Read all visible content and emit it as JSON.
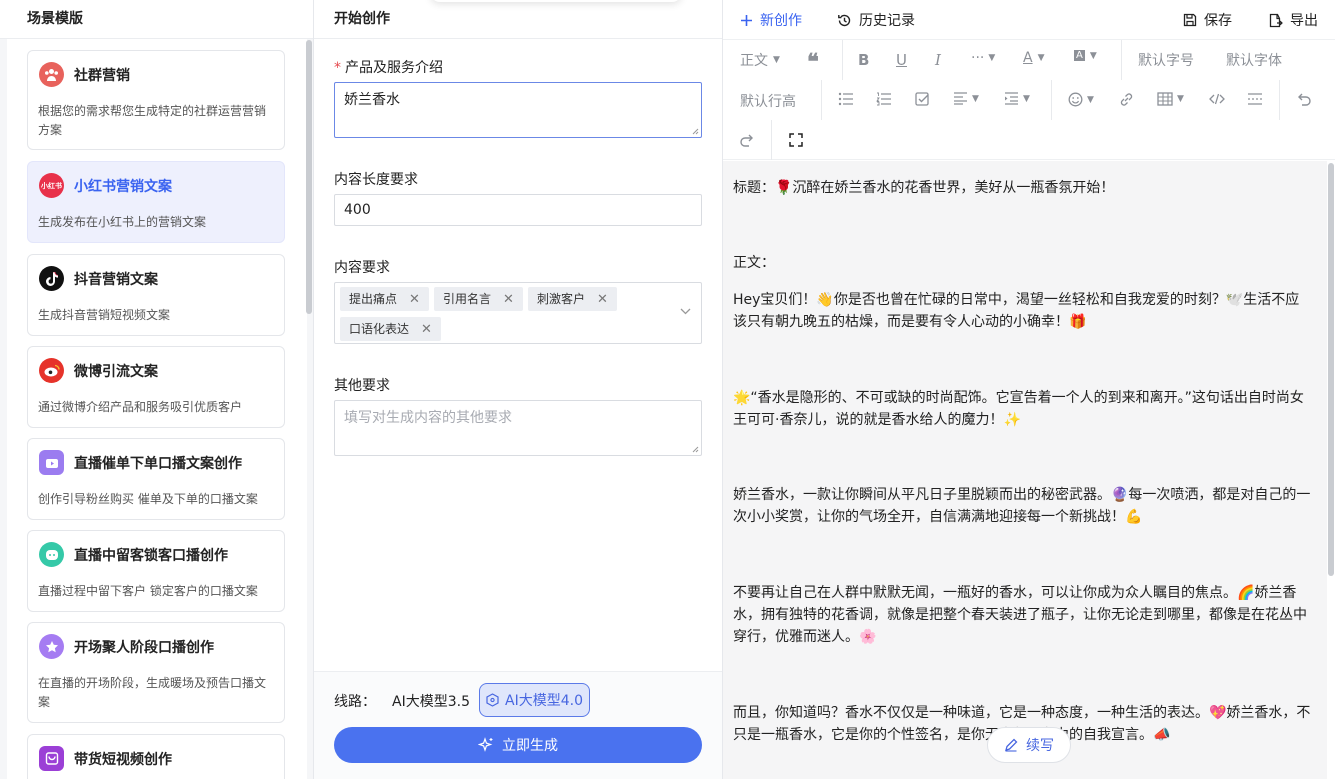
{
  "left": {
    "title": "场景模版",
    "cards": [
      {
        "title": "社群营销",
        "desc": "根据您的需求帮您生成特定的社群运营营销方案",
        "icon": "community-icon",
        "color": "#e8625c"
      },
      {
        "title": "小红书营销文案",
        "desc": "生成发布在小红书上的营销文案",
        "icon": "xiaohongshu-icon",
        "icon_text": "小红书",
        "color": "#e8314a"
      },
      {
        "title": "抖音营销文案",
        "desc": "生成抖音营销短视频文案",
        "icon": "douyin-icon",
        "color": "#111111"
      },
      {
        "title": "微博引流文案",
        "desc": "通过微博介绍产品和服务吸引优质客户",
        "icon": "weibo-icon",
        "color": "#e6332a"
      },
      {
        "title": "直播催单下单口播文案创作",
        "desc": "创作引导粉丝购买 催单及下单的口播文案",
        "icon": "live-order-icon",
        "color": "#9b7cf0"
      },
      {
        "title": "直播中留客锁客口播创作",
        "desc": "直播过程中留下客户 锁定客户的口播文案",
        "icon": "live-retain-icon",
        "color": "#35c9a8"
      },
      {
        "title": "开场聚人阶段口播创作",
        "desc": "在直播的开场阶段，生成暖场及预告口播文案",
        "icon": "opening-star-icon",
        "color": "#a57cf2"
      },
      {
        "title": "带货短视频创作",
        "desc": "",
        "icon": "shopping-video-icon",
        "color": "#9b3fd6"
      }
    ]
  },
  "form": {
    "title": "开始创作",
    "product_label": "产品及服务介绍",
    "product_value": "娇兰香水",
    "length_label": "内容长度要求",
    "length_value": "400",
    "content_label": "内容要求",
    "tags": [
      "提出痛点",
      "引用名言",
      "刺激客户",
      "口语化表达"
    ],
    "other_label": "其他要求",
    "other_placeholder": "填写对生成内容的其他要求",
    "route_label": "线路：",
    "model_35": "AI大模型3.5",
    "model_40": "AI大模型4.0",
    "generate": "立即生成"
  },
  "topbar": {
    "new": "新创作",
    "history": "历史记录",
    "save": "保存",
    "export": "导出"
  },
  "toolbar": {
    "paragraph": "正文",
    "font_size": "默认字号",
    "font_family": "默认字体",
    "line_height": "默认行高"
  },
  "editor": {
    "title_line": "标题：🌹沉醉在娇兰香水的花香世界，美好从一瓶香氛开始！",
    "body_label": "正文：",
    "p1": "Hey宝贝们！👋你是否也曾在忙碌的日常中，渴望一丝轻松和自我宠爱的时刻？🕊️生活不应该只有朝九晚五的枯燥，而是要有令人心动的小确幸！🎁",
    "p2": "🌟“香水是隐形的、不可或缺的时尚配饰。它宣告着一个人的到来和离开。”这句话出自时尚女王可可·香奈儿，说的就是香水给人的魔力！✨",
    "p3": "娇兰香水，一款让你瞬间从平凡日子里脱颖而出的秘密武器。🔮每一次喷洒，都是对自己的一次小小奖赏，让你的气场全开，自信满满地迎接每一个新挑战！💪",
    "p4": "不要再让自己在人群中默默无闻，一瓶好的香水，可以让你成为众人瞩目的焦点。🌈娇兰香水，拥有独特的花香调，就像是把整个春天装进了瓶子，让你无论走到哪里，都像是在花丛中穿行，优雅而迷人。🌸",
    "p5": "而且，你知道吗？香水不仅仅是一种味道，它是一种态度，一种生活的表达。💖娇兰香水，不只是一瓶香水，它是你的个性签名，是你无声却强有力的自我宣言。📣",
    "continue": "续写"
  }
}
